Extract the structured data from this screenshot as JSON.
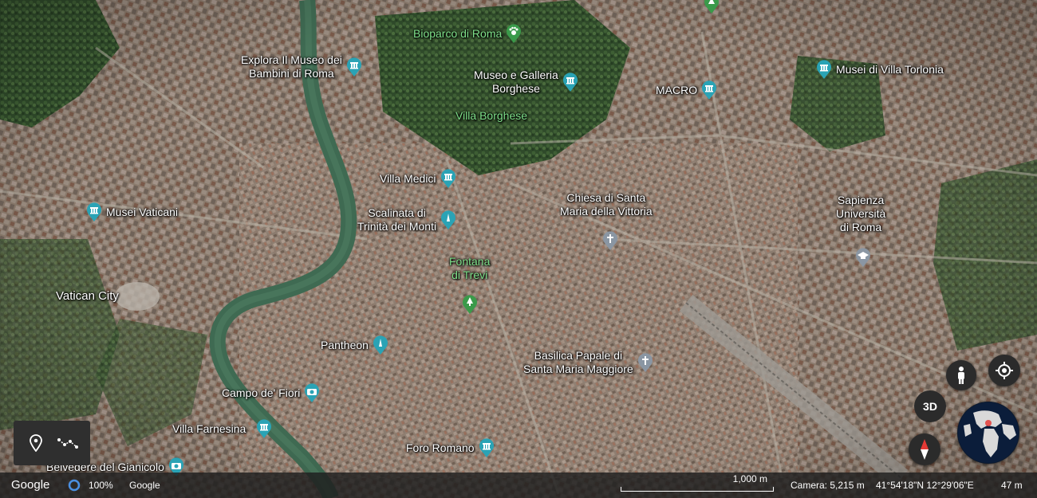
{
  "map": {
    "labels": {
      "explora": "Explora Il Museo dei",
      "explora2": "Bambini di Roma",
      "bioparco": "Bioparco di Roma",
      "borghese1": "Museo e Galleria",
      "borghese2": "Borghese",
      "villa_borghese": "Villa Borghese",
      "macro": "MACRO",
      "torlonia": "Musei di Villa Torlonia",
      "villa_medici": "Villa Medici",
      "scalinata1": "Scalinata di",
      "scalinata2": "Trinità dei Monti",
      "chiesa1": "Chiesa di Santa",
      "chiesa2": "Maria della Vittoria",
      "sapienza1": "Sapienza",
      "sapienza2": "Università",
      "sapienza3": "di Roma",
      "vaticani": "Musei Vaticani",
      "trevi1": "Fontana",
      "trevi2": "di Trevi",
      "vatican_city": "Vatican City",
      "pantheon": "Pantheon",
      "basilica1": "Basilica Papale di",
      "basilica2": "Santa Maria Maggiore",
      "campo": "Campo de' Fiori",
      "farnesina": "Villa Farnesina",
      "foro": "Foro Romano",
      "belvedere": "Belvedere del Gianicolo"
    }
  },
  "controls": {
    "three_d": "3D"
  },
  "status_bar": {
    "logo": "Google",
    "loading": "100%",
    "attribution": "Google",
    "scale": "1,000 m",
    "camera": "Camera: 5,215 m",
    "coords": "41°54'18\"N 12°29'06\"E",
    "elevation": "47 m"
  },
  "colors": {
    "pin_teal": "#2aa3b5",
    "pin_green": "#3a9a4a",
    "pin_gray": "#8a96a3",
    "river": "#3f6a52"
  }
}
